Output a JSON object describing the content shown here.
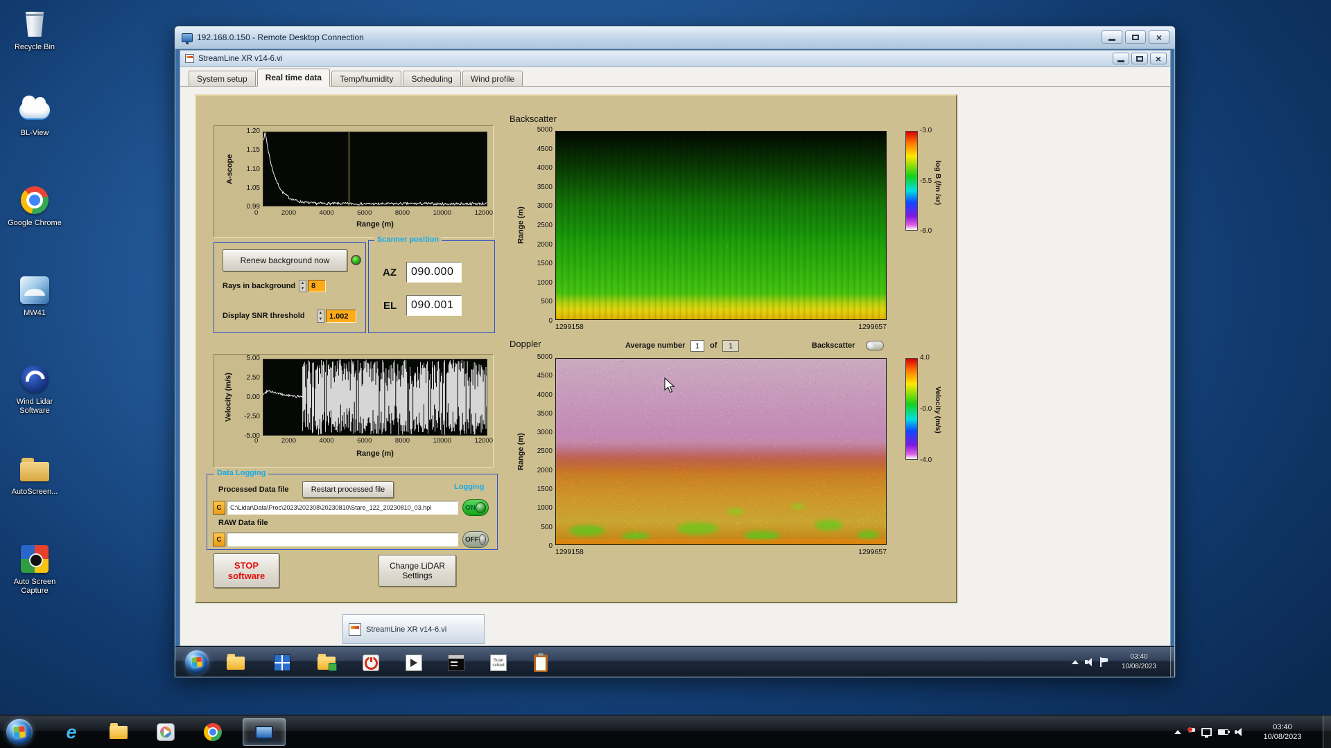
{
  "desktop": {
    "icons": [
      {
        "id": "recycle-bin",
        "label": "Recycle Bin"
      },
      {
        "id": "bl-view",
        "label": "BL-View"
      },
      {
        "id": "google-chrome",
        "label": "Google Chrome"
      },
      {
        "id": "mw41",
        "label": "MW41"
      },
      {
        "id": "wind-lidar",
        "label": "Wind Lidar Software"
      },
      {
        "id": "autoscreen",
        "label": "AutoScreen..."
      },
      {
        "id": "auto-screen-capture",
        "label": "Auto Screen Capture"
      }
    ]
  },
  "rdp_window": {
    "title": "192.168.0.150 - Remote Desktop Connection"
  },
  "vi_window": {
    "title": "StreamLine XR v14-6.vi",
    "tabs": [
      "System setup",
      "Real time data",
      "Temp/humidity",
      "Scheduling",
      "Wind profile"
    ],
    "active_tab": "Real time data"
  },
  "controls": {
    "renew_button": "Renew background now",
    "rays_label": "Rays in background",
    "rays_value": "8",
    "snr_label": "Display SNR threshold",
    "snr_value": "1.002",
    "scanner_title": "Scanner position",
    "az_label": "AZ",
    "az_value": "090.000",
    "el_label": "EL",
    "el_value": "090.001",
    "avg_label": "Average number",
    "avg_value": "1",
    "of_label": "of",
    "avg_total": "1",
    "backscatter_switch_label": "Backscatter",
    "stop_line1": "STOP",
    "stop_line2": "software",
    "change_line1": "Change LiDAR",
    "change_line2": "Settings"
  },
  "logging": {
    "title": "Data Logging",
    "processed_label": "Processed Data file",
    "restart_button": "Restart processed file",
    "logging_label": "Logging",
    "drive": "C",
    "processed_path": "C:\\Lidar\\Data\\Proc\\2023\\202308\\20230810\\Stare_122_20230810_03.hpl",
    "raw_label": "RAW Data file",
    "raw_path": "",
    "on_label": "ON",
    "off_label": "OFF"
  },
  "chart_data": {
    "ascope": {
      "type": "line",
      "ylabel": "A-scope",
      "xlabel": "Range (m)",
      "xlim": [
        0,
        12000
      ],
      "ylim": [
        0.99,
        1.2
      ],
      "xticks": [
        "0",
        "2000",
        "4000",
        "6000",
        "8000",
        "10000",
        "12000"
      ],
      "yticks": [
        "1.20",
        "1.15",
        "1.10",
        "1.05",
        "0.99"
      ],
      "cursor_x": 4600,
      "points": [
        [
          0,
          1.18
        ],
        [
          100,
          1.2
        ],
        [
          250,
          1.15
        ],
        [
          450,
          1.1
        ],
        [
          700,
          1.06
        ],
        [
          1000,
          1.03
        ],
        [
          1400,
          1.012
        ],
        [
          1900,
          1.002
        ],
        [
          2600,
          0.997
        ],
        [
          4000,
          0.996
        ],
        [
          6000,
          0.995
        ],
        [
          8000,
          0.996
        ],
        [
          10000,
          0.995
        ],
        [
          12000,
          0.996
        ]
      ],
      "noise": 0.0035
    },
    "velocity": {
      "type": "line",
      "ylabel": "Velocity (m/s)",
      "xlabel": "Range (m)",
      "xlim": [
        0,
        12000
      ],
      "ylim": [
        -5,
        5
      ],
      "xticks": [
        "0",
        "2000",
        "4000",
        "6000",
        "8000",
        "10000",
        "12000"
      ],
      "yticks": [
        "5.00",
        "2.50",
        "0.00",
        "-2.50",
        "-5.00"
      ],
      "signal_points": [
        [
          0,
          0.35
        ],
        [
          250,
          0.95
        ],
        [
          500,
          0.7
        ],
        [
          900,
          0.4
        ],
        [
          1400,
          0.2
        ],
        [
          2000,
          0.05
        ]
      ],
      "noise_start": 2100,
      "noise_amplitude": 5
    },
    "backscatter": {
      "type": "heatmap",
      "title": "Backscatter",
      "ylabel": "Range (m)",
      "yticks": [
        "5000",
        "4500",
        "4000",
        "3500",
        "3000",
        "2500",
        "2000",
        "1500",
        "1000",
        "500",
        "0"
      ],
      "x_start_label": "1299158",
      "x_end_label": "1299657",
      "colorbar_label": "log B (/m /sr)",
      "colorbar_ticks": [
        "-3.0",
        "-5.5",
        "-8.0"
      ],
      "content_summary": "Uniform high backscatter (green) below ~3500 m, bright yellow layer 0-400 m, black noise speckle increasing above ~3500 m"
    },
    "doppler": {
      "type": "heatmap",
      "title": "Doppler",
      "ylabel": "Range (m)",
      "yticks": [
        "5000",
        "4500",
        "4000",
        "3500",
        "3000",
        "2500",
        "2000",
        "1500",
        "1000",
        "500",
        "0"
      ],
      "x_start_label": "1299158",
      "x_end_label": "1299657",
      "colorbar_label": "Velocity (m/s)",
      "colorbar_ticks": [
        "4.0",
        "-0.0",
        "-4.0"
      ],
      "content_summary": "Magenta/white noise above ~2500 m, yellow-orange negative velocities below, green patches near surface"
    }
  },
  "remote_taskbar": {
    "app_button": "StreamLine XR v14-6.vi",
    "scan_line1": "Scan",
    "scan_line2": "sched",
    "tray_time": "03:40",
    "tray_date": "10/08/2023"
  },
  "host_taskbar": {
    "ie_glyph": "e",
    "tray_time": "03:40",
    "tray_date": "10/08/2023"
  }
}
